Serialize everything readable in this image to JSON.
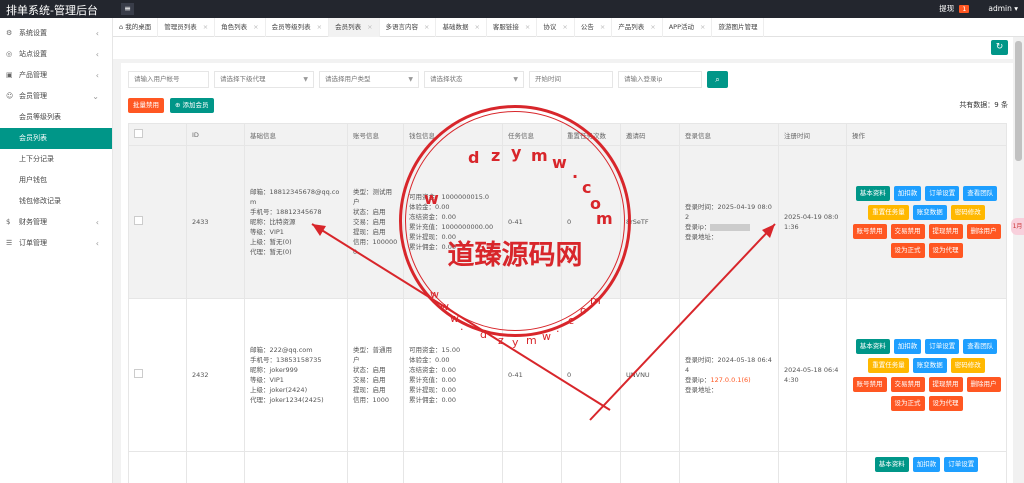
{
  "app": {
    "title": "排单系统-管理后台",
    "menu_icon": "hamburger-icon"
  },
  "topbar": {
    "cash_label": "提现",
    "cash_count": "1",
    "user": "admin"
  },
  "sidebar": {
    "items": [
      {
        "label": "系统设置",
        "icon": "gear-icon"
      },
      {
        "label": "站点设置",
        "icon": "site-icon"
      },
      {
        "label": "产品管理",
        "icon": "product-icon"
      },
      {
        "label": "会员管理",
        "icon": "user-icon"
      }
    ],
    "member_sub": [
      "会员等级列表",
      "会员列表",
      "上下分记录",
      "用户钱包",
      "钱包修改记录"
    ],
    "items2": [
      {
        "label": "财务管理",
        "icon": "finance-icon"
      },
      {
        "label": "订单管理",
        "icon": "order-icon"
      }
    ]
  },
  "tabs": [
    {
      "label": "我的桌面",
      "icon": "home-icon",
      "closable": false
    },
    {
      "label": "管理员列表",
      "closable": true
    },
    {
      "label": "角色列表",
      "closable": true
    },
    {
      "label": "会员等级列表",
      "closable": true
    },
    {
      "label": "会员列表",
      "closable": true,
      "active": true
    },
    {
      "label": "多语言内容",
      "closable": true
    },
    {
      "label": "基础数据",
      "closable": true
    },
    {
      "label": "客服链接",
      "closable": true
    },
    {
      "label": "协议",
      "closable": true
    },
    {
      "label": "公告",
      "closable": true
    },
    {
      "label": "产品列表",
      "closable": true
    },
    {
      "label": "APP活动",
      "closable": true
    },
    {
      "label": "旅游图片管理",
      "closable": false
    }
  ],
  "refresh_icon": "refresh-icon",
  "filters": {
    "account_placeholder": "请输入用户帐号",
    "agent_placeholder": "请选择下级代理",
    "user_type_placeholder": "请选择用户类型",
    "status_placeholder": "请选择状态",
    "start_time_placeholder": "开始时间",
    "login_ip_placeholder": "请输入登录ip",
    "search_icon": "search-icon"
  },
  "actions": {
    "batch_disable": "批量禁用",
    "add_member": "添加会员"
  },
  "total_label": "共有数据：9 条",
  "table": {
    "headers": [
      "",
      "ID",
      "基础信息",
      "账号信息",
      "钱包信息",
      "任务信息",
      "重置任务次数",
      "邀请码",
      "登录信息",
      "注册时间",
      "操作"
    ],
    "rows": [
      {
        "id": "2433",
        "basic": [
          "邮箱：18812345678@qq.com",
          "手机号：18812345678",
          "昵称：比特资源",
          "等级：VIP1",
          "上级：暂无(0)",
          "代理：暂无(0)"
        ],
        "account": [
          "类型：测试用户",
          "状态：启用",
          "交易：启用",
          "提现：启用",
          "信用：1000000"
        ],
        "wallet": [
          "可用资金：1000000015.0",
          "体验金：0.00",
          "冻结资金：0.00",
          "累计充值：1000000000.00",
          "累计提现：0.00",
          "累计佣金：0.00"
        ],
        "task": "0-41",
        "reset": "0",
        "invite": "8rSeTF",
        "login": [
          "登录时间：2025-04-19 08:02",
          "登录ip：",
          "登录地址："
        ],
        "login_ip": "",
        "reg_time": "2025-04-19 08:01:36"
      },
      {
        "id": "2432",
        "basic": [
          "邮箱：222@qq.com",
          "手机号：13853158735",
          "昵称：joker999",
          "等级：VIP1",
          "上级：joker(2424)",
          "代理：joker1234(2425)"
        ],
        "account": [
          "类型：普通用户",
          "状态：启用",
          "交易：启用",
          "提现：启用",
          "信用：1000"
        ],
        "wallet": [
          "可用资金：15.00",
          "体验金：0.00",
          "冻结资金：0.00",
          "累计充值：0.00",
          "累计提现：0.00",
          "累计佣金：0.00"
        ],
        "task": "0-41",
        "reset": "0",
        "invite": "UNVNU",
        "login": [
          "登录时间：2024-05-18 06:44",
          "登录ip：",
          "登录地址："
        ],
        "login_ip": "127.0.0.1(6)",
        "reg_time": "2024-05-18 06:44:30"
      }
    ],
    "action_buttons": [
      {
        "label": "基本资料",
        "color": "#009688"
      },
      {
        "label": "加扣款",
        "color": "#1e9fff"
      },
      {
        "label": "订单设置",
        "color": "#1e9fff"
      },
      {
        "label": "查看团队",
        "color": "#1e9fff"
      },
      {
        "label": "重置任务量",
        "color": "#ffb800"
      },
      {
        "label": "账变数据",
        "color": "#1e9fff"
      },
      {
        "label": "密码修改",
        "color": "#ffb800"
      },
      {
        "label": "账号禁用",
        "color": "#ff5722"
      },
      {
        "label": "交易禁用",
        "color": "#ff5722"
      },
      {
        "label": "提现禁用",
        "color": "#ff5722"
      },
      {
        "label": "删除用户",
        "color": "#ff5722"
      },
      {
        "label": "设为正式",
        "color": "#ff5722"
      },
      {
        "label": "设为代理",
        "color": "#ff5722"
      }
    ],
    "third_row_buttons": [
      "基本资料",
      "加扣款",
      "订单设置"
    ]
  },
  "watermark": {
    "center_text": "道臻源码网",
    "upper_letters": [
      "d",
      "z",
      "y",
      "m",
      "w",
      ".",
      "c",
      "o",
      "m"
    ],
    "lower_letters": [
      "w",
      "w",
      "w",
      ".",
      "d",
      "z",
      "y",
      "m",
      "w",
      ".",
      "c",
      "o",
      "m"
    ],
    "left_w": "w",
    "color": "#d8262b"
  },
  "side_pill": "1月"
}
